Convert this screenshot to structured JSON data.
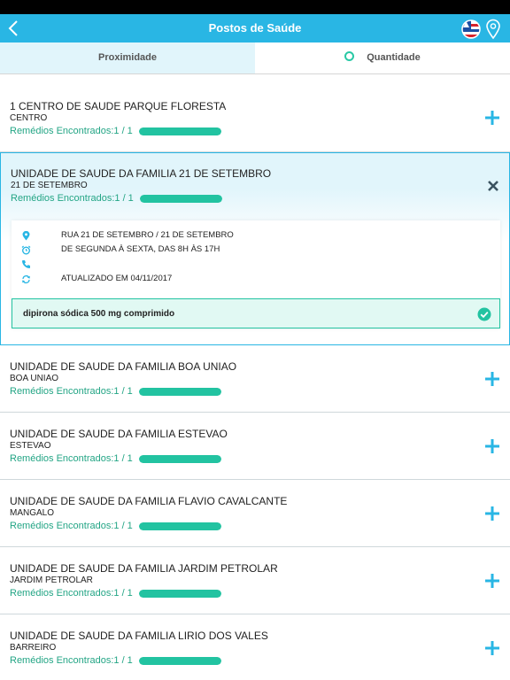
{
  "header": {
    "title": "Postos de Saúde",
    "back_icon": "chevron-left-icon",
    "flag_icon": "bahia-flag-icon",
    "location_icon": "location-pin-icon",
    "bar_color": "#29b6e4"
  },
  "tabs": [
    {
      "label": "Proximidade",
      "selected": true
    },
    {
      "label": "Quantidade",
      "selected": false
    }
  ],
  "colors": {
    "accent": "#29b6e4",
    "success": "#22c3a1"
  },
  "postos": [
    {
      "name": "1 CENTRO DE SAUDE PARQUE FLORESTA",
      "bairro": "CENTRO",
      "remedios": "Remédios Encontrados:1 / 1",
      "progress": 1.0,
      "expanded": false
    },
    {
      "name": "UNIDADE DE SAUDE DA FAMILIA 21 DE SETEMBRO",
      "bairro": "21 DE SETEMBRO",
      "remedios": "Remédios Encontrados:1 / 1",
      "progress": 1.0,
      "expanded": true,
      "details": {
        "endereco": "RUA 21 DE SETEMBRO / 21 DE SETEMBRO",
        "horario": "DE SEGUNDA À SEXTA, DAS 8H ÀS 17H",
        "telefone": "",
        "atualizado": "ATUALIZADO EM 04/11/2017",
        "medicamento": "dipirona sódica 500 mg comprimido"
      }
    },
    {
      "name": "UNIDADE DE SAUDE DA FAMILIA BOA UNIAO",
      "bairro": "BOA UNIAO",
      "remedios": "Remédios Encontrados:1 / 1",
      "progress": 1.0,
      "expanded": false
    },
    {
      "name": "UNIDADE DE SAUDE DA FAMILIA ESTEVAO",
      "bairro": "ESTEVAO",
      "remedios": "Remédios Encontrados:1 / 1",
      "progress": 1.0,
      "expanded": false
    },
    {
      "name": "UNIDADE DE SAUDE DA FAMILIA FLAVIO CAVALCANTE",
      "bairro": "MANGALO",
      "remedios": "Remédios Encontrados:1 / 1",
      "progress": 1.0,
      "expanded": false
    },
    {
      "name": "UNIDADE DE SAUDE DA FAMILIA JARDIM PETROLAR",
      "bairro": "JARDIM PETROLAR",
      "remedios": "Remédios Encontrados:1 / 1",
      "progress": 1.0,
      "expanded": false
    },
    {
      "name": "UNIDADE DE SAUDE DA FAMILIA LIRIO DOS VALES",
      "bairro": "BARREIRO",
      "remedios": "Remédios Encontrados:1 / 1",
      "progress": 1.0,
      "expanded": false
    }
  ]
}
